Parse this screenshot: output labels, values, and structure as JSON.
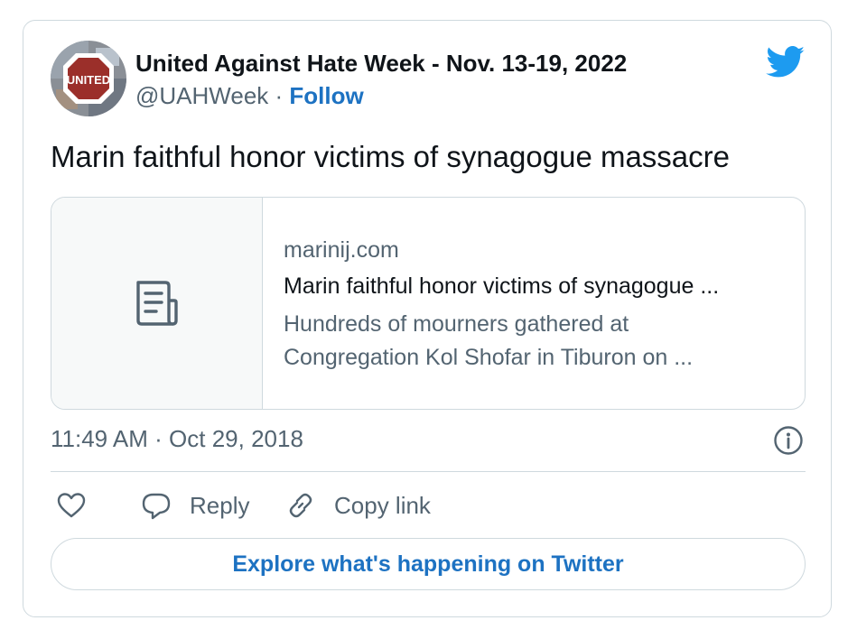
{
  "tweet": {
    "author_name": "United Against Hate Week - Nov. 13-19, 2022",
    "handle": "@UAHWeek",
    "separator": "·",
    "follow_label": "Follow",
    "text": "Marin faithful honor victims of synagogue massacre",
    "timestamp": "11:49 AM · Oct 29, 2018",
    "avatar_text": "UNITED"
  },
  "link_card": {
    "domain": "marinij.com",
    "title": "Marin faithful honor victims of synagogue ...",
    "description_line1": "Hundreds of mourners gathered at",
    "description_line2": "Congregation Kol Shofar in Tiburon on ...",
    "thumbnail_icon": "document-icon"
  },
  "actions": {
    "like_icon": "heart-icon",
    "reply_label": "Reply",
    "copy_link_label": "Copy link"
  },
  "explore_label": "Explore what's happening on Twitter",
  "colors": {
    "link_blue": "#1d72c2",
    "twitter_blue": "#1d9bf0",
    "secondary_text": "#536471",
    "border": "#cfd9de"
  }
}
